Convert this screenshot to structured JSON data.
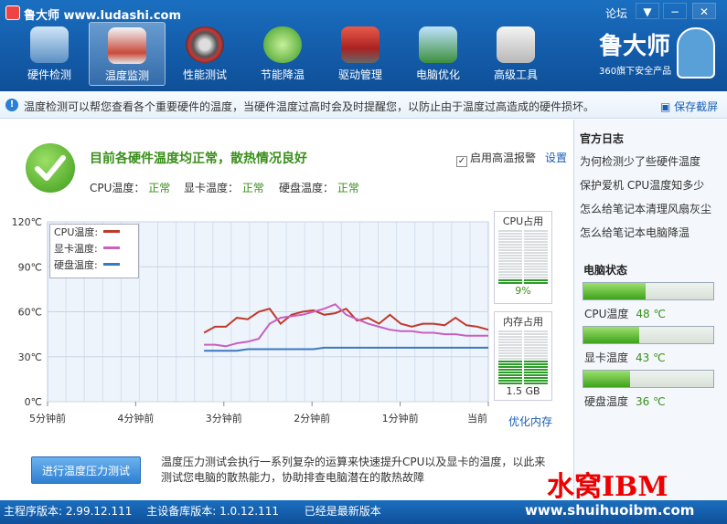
{
  "window": {
    "title": "鲁大师 www.ludashi.com",
    "forum": "论坛",
    "btn_menu": "▼",
    "btn_min": "−",
    "btn_close": "✕"
  },
  "toolbar": {
    "items": [
      {
        "label": "硬件检测",
        "icon": "monitor-magnifier-icon"
      },
      {
        "label": "温度监测",
        "icon": "thermometer-icon",
        "active": true
      },
      {
        "label": "性能测试",
        "icon": "speedometer-icon"
      },
      {
        "label": "节能降温",
        "icon": "clover-icon"
      },
      {
        "label": "驱动管理",
        "icon": "toolbox-icon"
      },
      {
        "label": "电脑优化",
        "icon": "broom-monitor-icon"
      },
      {
        "label": "高级工具",
        "icon": "toolcase-icon"
      }
    ]
  },
  "brand": {
    "name": "鲁大师",
    "tagline": "360旗下安全产品"
  },
  "info": {
    "text": "温度检测可以帮您查看各个重要硬件的温度，当硬件温度过高时会及时提醒您，以防止由于温度过高造成的硬件损坏。",
    "save": "保存截屏"
  },
  "status": {
    "title": "目前各硬件温度均正常，散热情况良好",
    "cpu_label": "CPU温度：",
    "cpu_value": "正常",
    "gpu_label": "显卡温度：",
    "gpu_value": "正常",
    "disk_label": "硬盘温度：",
    "disk_value": "正常",
    "alarm": "启用高温报警",
    "settings": "设置"
  },
  "chart_data": {
    "type": "line",
    "y_ticks": [
      "120℃",
      "90℃",
      "60℃",
      "30℃",
      "0℃"
    ],
    "ylim": [
      0,
      120
    ],
    "x_ticks": [
      "5分钟前",
      "4分钟前",
      "3分钟前",
      "2分钟前",
      "1分钟前",
      "当前"
    ],
    "series": [
      {
        "name": "CPU温度:",
        "color": "#c03a2b",
        "values": [
          46,
          50,
          50,
          56,
          55,
          60,
          62,
          52,
          58,
          60,
          61,
          58,
          59,
          62,
          54,
          56,
          52,
          58,
          52,
          50,
          52,
          52,
          51,
          56,
          51,
          50,
          48
        ]
      },
      {
        "name": "显卡温度:",
        "color": "#c860c0",
        "values": [
          38,
          38,
          37,
          39,
          40,
          42,
          52,
          56,
          57,
          58,
          60,
          62,
          65,
          58,
          55,
          52,
          50,
          48,
          47,
          47,
          46,
          46,
          45,
          45,
          44,
          44,
          44
        ]
      },
      {
        "name": "硬盘温度:",
        "color": "#3a78c0",
        "values": [
          34,
          34,
          34,
          34,
          35,
          35,
          35,
          35,
          35,
          35,
          35,
          36,
          36,
          36,
          36,
          36,
          36,
          36,
          36,
          36,
          36,
          36,
          36,
          36,
          36,
          36,
          36
        ]
      }
    ],
    "grid": true,
    "legend": "top-left"
  },
  "meters": {
    "cpu_title": "CPU占用",
    "cpu_value": "9%",
    "cpu_level": 0.09,
    "mem_title": "内存占用",
    "mem_value": "1.5 GB",
    "mem_level": 0.45,
    "optimize": "优化内存"
  },
  "stress": {
    "button": "进行温度压力测试",
    "desc": "温度压力测试会执行一系列复杂的运算来快速提升CPU以及显卡的温度，以此来测试您电脑的散热能力，协助排查电脑潜在的散热故障"
  },
  "side": {
    "log_title": "官方日志",
    "links": [
      "为何检测少了些硬件温度",
      "保护爱机 CPU温度知多少",
      "怎么给笔记本清理风扇灰尘",
      "怎么给笔记本电脑降温"
    ],
    "pc_title": "电脑状态",
    "bars": [
      {
        "label": "CPU温度",
        "value": "48 ℃",
        "level": 0.48
      },
      {
        "label": "显卡温度",
        "value": "43 ℃",
        "level": 0.43
      },
      {
        "label": "硬盘温度",
        "value": "36 ℃",
        "level": 0.36
      }
    ]
  },
  "statusbar": {
    "main_version": "主程序版本: 2.99.12.111",
    "db_version": "主设备库版本: 1.0.12.111",
    "latest": "已经是最新版本"
  },
  "watermark": {
    "text": "水窝IBM",
    "url": "www.shuihuoibm.com"
  }
}
